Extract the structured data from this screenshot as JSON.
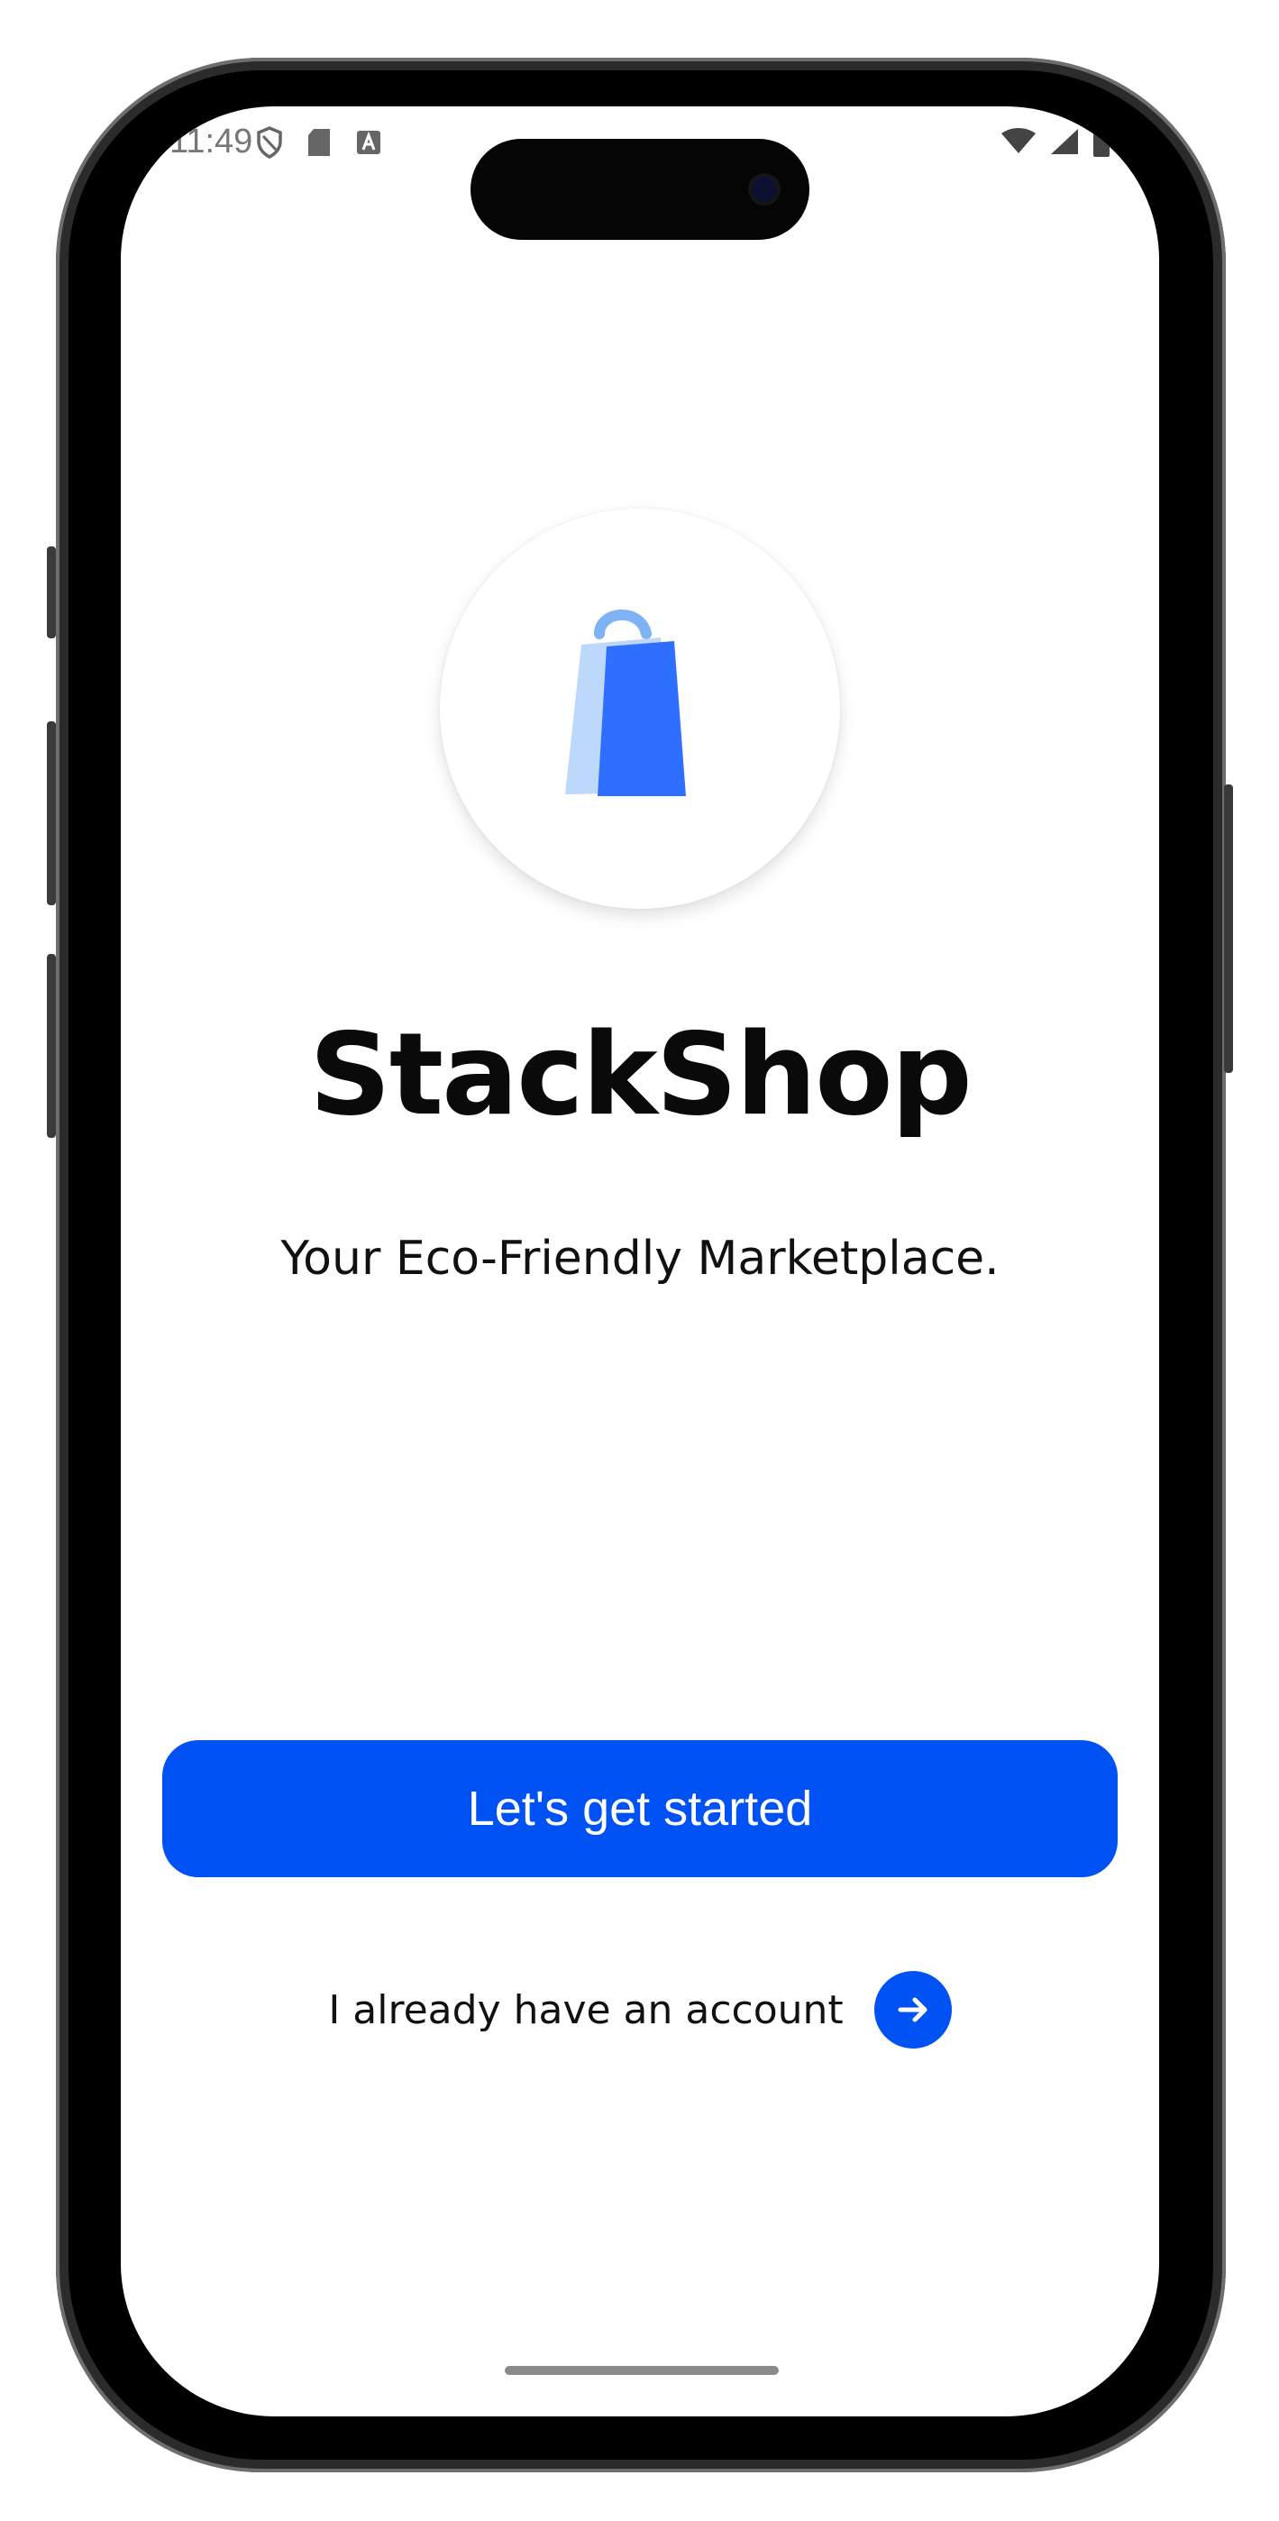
{
  "status_bar": {
    "time": "11:49",
    "left_icons": [
      "shield-icon",
      "sd-card-icon",
      "a-notification-icon"
    ],
    "right_icons": [
      "wifi-icon",
      "signal-icon",
      "battery-icon"
    ]
  },
  "logo": {
    "icon": "shopping-bag-icon",
    "colors": {
      "front": "#2f6fff",
      "back": "#bcd8fb",
      "handle": "#7fb2f5"
    }
  },
  "app": {
    "title": "StackShop",
    "tagline": "Your Eco-Friendly Marketplace."
  },
  "actions": {
    "primary_label": "Let's get started",
    "secondary_label": "I already have an account",
    "secondary_icon": "arrow-right-icon"
  },
  "colors": {
    "accent": "#0052f5",
    "text": "#111111",
    "background": "#ffffff"
  }
}
